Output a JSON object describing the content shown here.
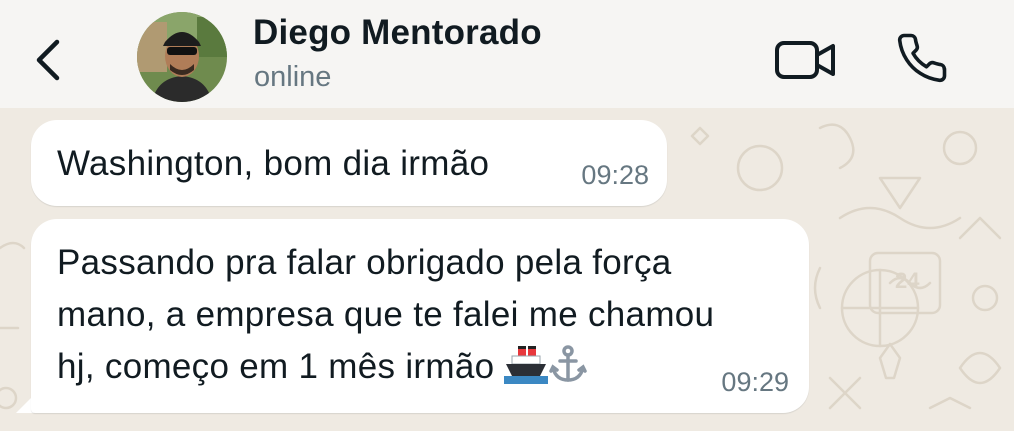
{
  "header": {
    "back_icon": "arrow-left-icon",
    "contact_name": "Diego Mentorado",
    "status": "online",
    "video_icon": "video-camera-icon",
    "call_icon": "phone-icon"
  },
  "messages": [
    {
      "direction": "incoming",
      "lines": [
        "Washington, bom dia irmão"
      ],
      "time": "09:28"
    },
    {
      "direction": "incoming",
      "lines": [
        "Passando pra falar obrigado pela força",
        "mano, a empresa que te falei me chamou",
        "hj, começo em 1 mês irmão"
      ],
      "emojis": [
        "ship-emoji",
        "anchor-emoji"
      ],
      "time": "09:29"
    }
  ],
  "colors": {
    "header_bg": "#f6f5f3",
    "chat_bg": "#efeae2",
    "bubble_bg": "#ffffff",
    "text": "#111b21",
    "secondary_text": "#667781"
  }
}
